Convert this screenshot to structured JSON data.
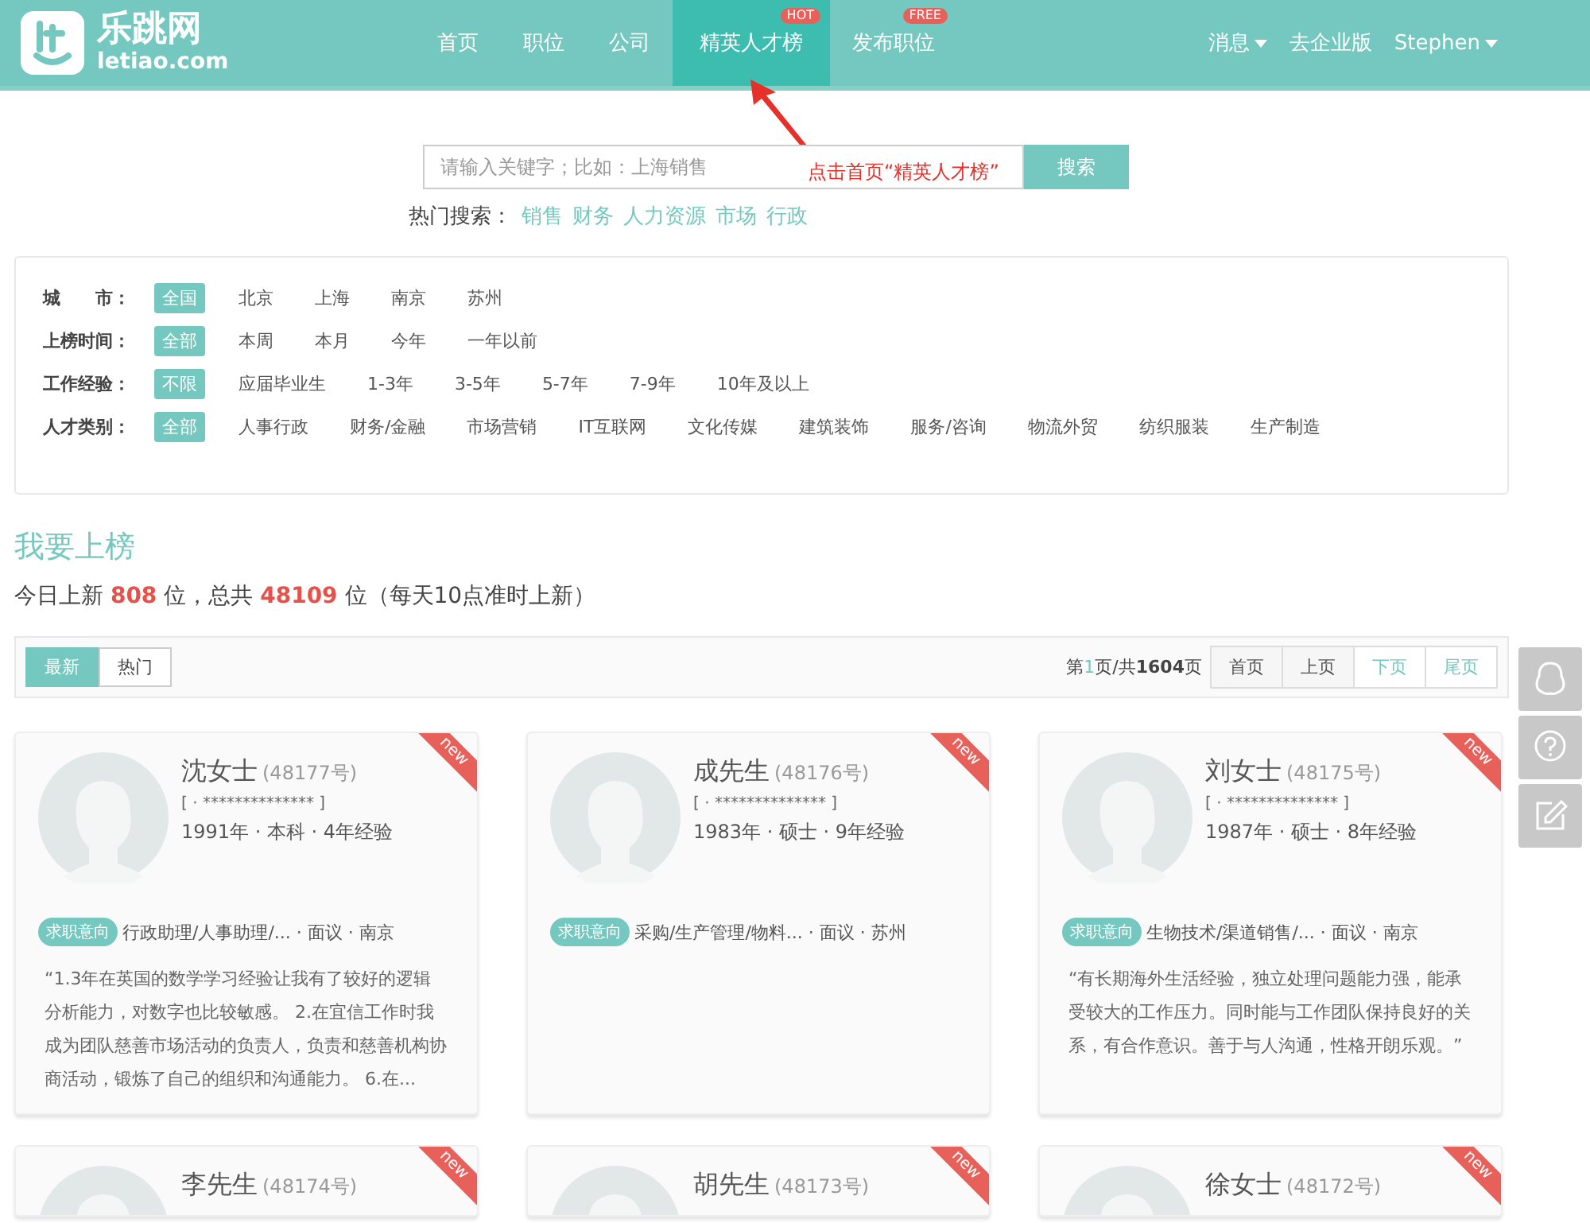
{
  "logo": {
    "name": "乐跳网",
    "domain": "letiao.com"
  },
  "nav": [
    {
      "label": "首页",
      "selected": false
    },
    {
      "label": "职位",
      "selected": false
    },
    {
      "label": "公司",
      "selected": false
    },
    {
      "label": "精英人才榜",
      "selected": true,
      "badge": "HOT"
    },
    {
      "label": "发布职位",
      "selected": false,
      "badge": "FREE"
    }
  ],
  "nav_right": [
    {
      "label": "消息",
      "kind": "dropdown"
    },
    {
      "label": "去企业版",
      "kind": "link"
    },
    {
      "label": "Stephen",
      "kind": "dropdown"
    }
  ],
  "search": {
    "placeholder": "请输入关键字；比如：上海销售",
    "button": "搜索"
  },
  "annotation": {
    "text": "点击首页“精英人才榜”"
  },
  "hot_search": {
    "label": "热门搜索：",
    "terms": [
      "销售",
      "财务",
      "人力资源",
      "市场",
      "行政"
    ]
  },
  "filters": [
    {
      "label": "城　　市：",
      "options": [
        {
          "label": "全国",
          "selected": true
        },
        {
          "label": "北京",
          "selected": false
        },
        {
          "label": "上海",
          "selected": false
        },
        {
          "label": "南京",
          "selected": false
        },
        {
          "label": "苏州",
          "selected": false
        }
      ]
    },
    {
      "label": "上榜时间：",
      "options": [
        {
          "label": "全部",
          "selected": true
        },
        {
          "label": "本周",
          "selected": false
        },
        {
          "label": "本月",
          "selected": false
        },
        {
          "label": "今年",
          "selected": false
        },
        {
          "label": "一年以前",
          "selected": false
        }
      ]
    },
    {
      "label": "工作经验：",
      "options": [
        {
          "label": "不限",
          "selected": true
        },
        {
          "label": "应届毕业生",
          "selected": false
        },
        {
          "label": "1-3年",
          "selected": false
        },
        {
          "label": "3-5年",
          "selected": false
        },
        {
          "label": "5-7年",
          "selected": false
        },
        {
          "label": "7-9年",
          "selected": false
        },
        {
          "label": "10年及以上",
          "selected": false
        }
      ]
    },
    {
      "label": "人才类别：",
      "options": [
        {
          "label": "全部",
          "selected": true
        },
        {
          "label": "人事行政",
          "selected": false
        },
        {
          "label": "财务/金融",
          "selected": false
        },
        {
          "label": "市场营销",
          "selected": false
        },
        {
          "label": "IT互联网",
          "selected": false
        },
        {
          "label": "文化传媒",
          "selected": false
        },
        {
          "label": "建筑装饰",
          "selected": false
        },
        {
          "label": "服务/咨询",
          "selected": false
        },
        {
          "label": "物流外贸",
          "selected": false
        },
        {
          "label": "纺织服装",
          "selected": false
        },
        {
          "label": "生产制造",
          "selected": false
        }
      ]
    }
  ],
  "section_title": "我要上榜",
  "stats": "今日上新 **808** 位，总共 **48109** 位（每天10点准时上新）",
  "sort_tabs": [
    {
      "label": "最新",
      "selected": true
    },
    {
      "label": "热门",
      "selected": false
    }
  ],
  "page_info": "第**1**页/共**1604**页",
  "page_buttons": [
    {
      "label": "首页",
      "disabled": true
    },
    {
      "label": "上页",
      "disabled": true
    },
    {
      "label": "下页",
      "disabled": false
    },
    {
      "label": "尾页",
      "disabled": false
    }
  ],
  "cards": [
    {
      "name": "沈女士",
      "number": "(48177号)",
      "masked": "[ · ************** ]",
      "info": "1991年 · 本科 · 4年经验",
      "tag": "求职意向",
      "intent": "行政助理/人事助理/... · 面议 · 南京",
      "quote": "“1.3年在英国的数学学习经验让我有了较好的逻辑分析能力，对数字也比较敏感。 2.在宜信工作时我成为团队慈善市场活动的负责人，负责和慈善机构协商活动，锻炼了自己的组织和沟通能力。 6.在...",
      "ribbon": "new"
    },
    {
      "name": "成先生",
      "number": "(48176号)",
      "masked": "[ · ************** ]",
      "info": "1983年 · 硕士 · 9年经验",
      "tag": "求职意向",
      "intent": "采购/生产管理/物料... · 面议 · 苏州",
      "ribbon": "new"
    },
    {
      "name": "刘女士",
      "number": "(48175号)",
      "masked": "[ · ************** ]",
      "info": "1987年 · 硕士 · 8年经验",
      "tag": "求职意向",
      "intent": "生物技术/渠道销售/... · 面议 · 南京",
      "quote": "“有长期海外生活经验，独立处理问题能力强，能承受较大的工作压力。同时能与工作团队保持良好的关系，有合作意识。善于与人沟通，性格开朗乐观。”",
      "ribbon": "new"
    },
    {
      "name": "李先生",
      "number": "(48174号)",
      "ribbon": "new"
    },
    {
      "name": "胡先生",
      "number": "(48173号)",
      "ribbon": "new"
    },
    {
      "name": "徐女士",
      "number": "(48172号)",
      "ribbon": "new"
    }
  ]
}
